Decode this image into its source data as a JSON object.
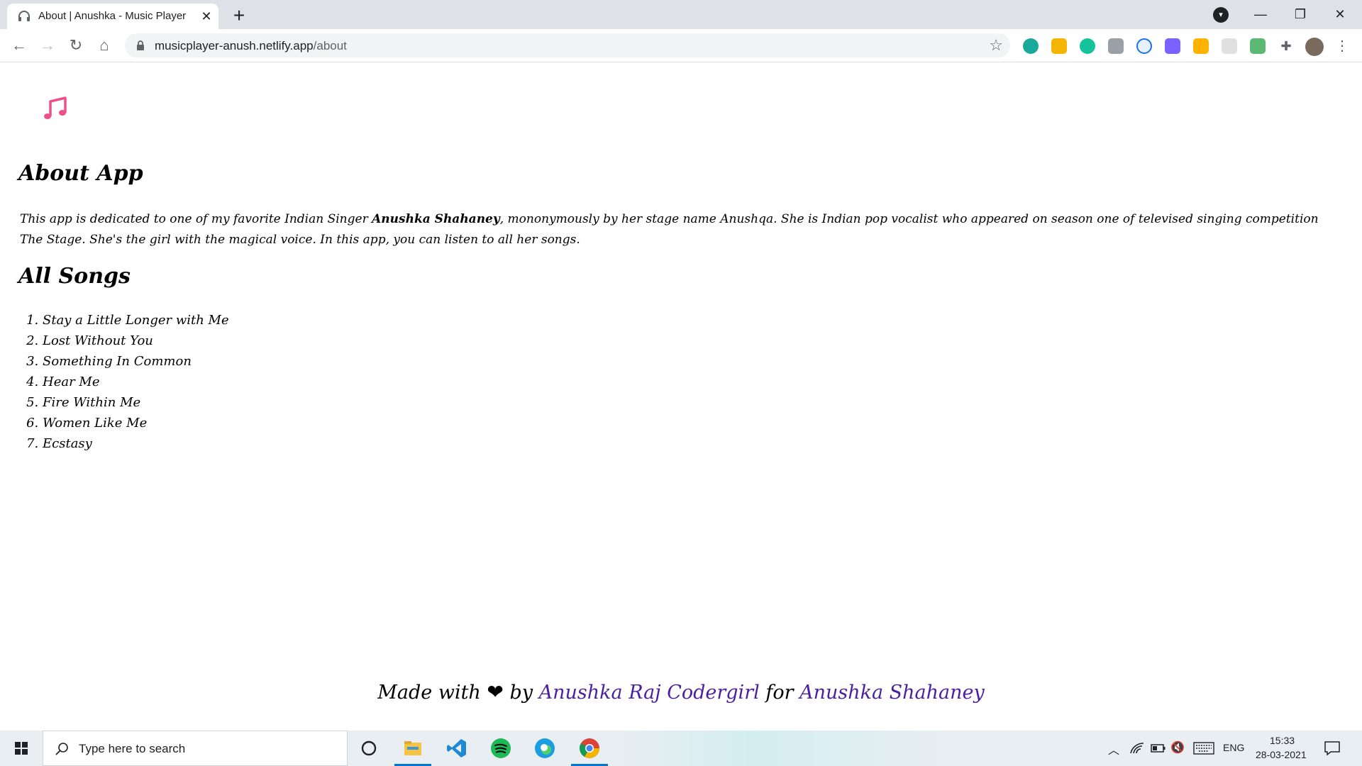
{
  "browser": {
    "tab_title": "About | Anushka - Music Player",
    "tab_close": "✕",
    "new_tab": "+",
    "url_host": "musicplayer-anush.netlify.app",
    "url_path": "/about",
    "icons": [
      "back-icon",
      "forward-icon",
      "reload-icon",
      "home-icon",
      "lock-icon",
      "star-icon",
      "extensions-icon",
      "menu-icon"
    ]
  },
  "page": {
    "about_heading": "About App",
    "about_text_before": "This app is dedicated to one of my favorite Indian Singer ",
    "about_text_bold": "Anushka Shahaney",
    "about_text_after": ", mononymously by her stage name Anushqa. She is Indian pop vocalist who appeared on season one of televised singing competition The Stage. She's the girl with the magical voice. In this app, you can listen to all her songs.",
    "songs_heading": "All Songs",
    "songs": [
      "Stay a Little Longer with Me",
      "Lost Without You",
      "Something In Common",
      "Hear Me",
      "Fire Within Me",
      "Women Like Me",
      "Ecstasy"
    ],
    "footer": {
      "made_with": "Made with",
      "heart": "❤",
      "by": "by",
      "author": "Anushka Raj Codergirl",
      "for": "for",
      "singer": "Anushka Shahaney"
    },
    "accent_color": "#f0508a",
    "link_color": "#4a1fa0"
  },
  "taskbar": {
    "search_placeholder": "Type here to search",
    "language": "ENG",
    "time": "15:33",
    "date": "28-03-2021"
  }
}
